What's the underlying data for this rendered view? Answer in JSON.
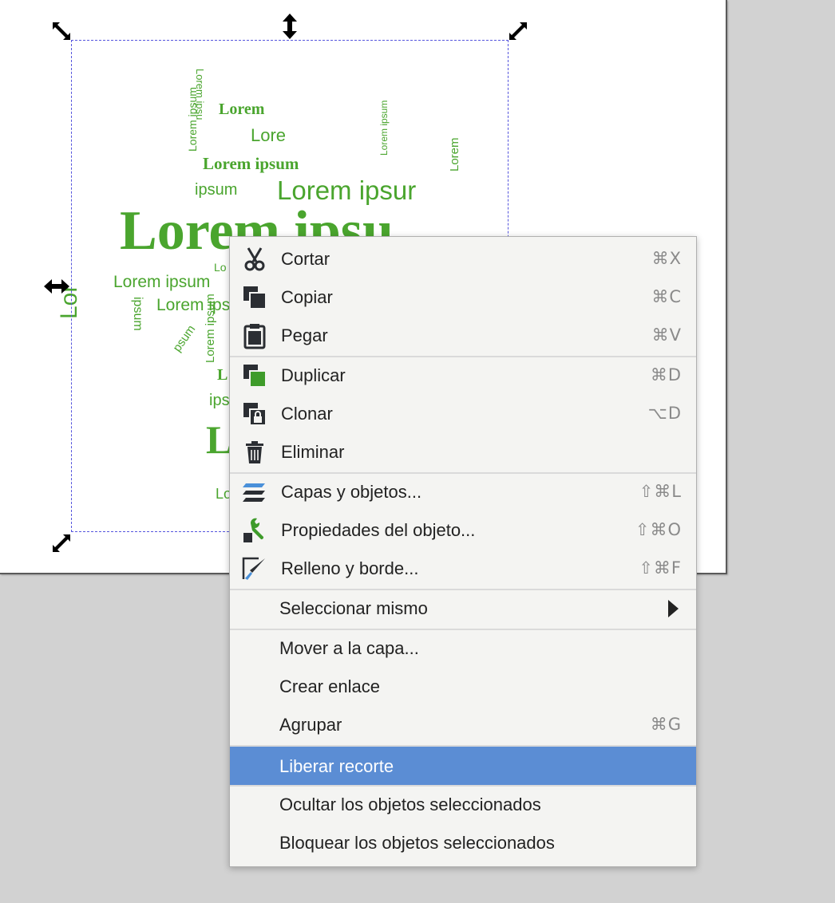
{
  "canvas": {
    "page_color": "#ffffff",
    "background_color": "#d2d2d2",
    "text_color": "#4aa52e",
    "word_cloud": [
      "Lorem ipsu",
      "Lorem",
      "Lore",
      "Lorem ipsum",
      "ipsum",
      "Lorem ipsur",
      "Lorem ipsu",
      "Lorem ipsum",
      "Lorem ipsum",
      "ipsum",
      "psum",
      "Lorem ipsum",
      "Lor",
      "Lo",
      "Lorem",
      "Lorem ipsum",
      "Lorem ipsum",
      "L",
      "ips",
      "Lo",
      "Lor"
    ],
    "selection_color": "#5555dd"
  },
  "context_menu": {
    "highlight_color": "#5b8dd4",
    "items": [
      {
        "label": "Cortar",
        "shortcut": "⌘X",
        "icon": "scissors-icon"
      },
      {
        "label": "Copiar",
        "shortcut": "⌘C",
        "icon": "copy-icon"
      },
      {
        "label": "Pegar",
        "shortcut": "⌘V",
        "icon": "paste-icon"
      },
      {
        "label": "Duplicar",
        "shortcut": "⌘D",
        "icon": "duplicate-icon"
      },
      {
        "label": "Clonar",
        "shortcut": "⌥D",
        "icon": "clone-icon"
      },
      {
        "label": "Eliminar",
        "shortcut": "",
        "icon": "trash-icon"
      },
      {
        "label": "Capas y objetos...",
        "shortcut": "⇧⌘L",
        "icon": "layers-icon"
      },
      {
        "label": "Propiedades del objeto...",
        "shortcut": "⇧⌘O",
        "icon": "wrench-icon"
      },
      {
        "label": "Relleno y borde...",
        "shortcut": "⇧⌘F",
        "icon": "fill-stroke-icon"
      },
      {
        "label": "Seleccionar mismo",
        "shortcut": "",
        "icon": "submenu-arrow-icon"
      },
      {
        "label": "Mover a la capa...",
        "shortcut": ""
      },
      {
        "label": "Crear enlace",
        "shortcut": ""
      },
      {
        "label": "Agrupar",
        "shortcut": "⌘G"
      },
      {
        "label": "Liberar recorte",
        "shortcut": "",
        "highlighted": true
      },
      {
        "label": "Ocultar los objetos seleccionados",
        "shortcut": ""
      },
      {
        "label": "Bloquear los objetos seleccionados",
        "shortcut": ""
      }
    ]
  }
}
